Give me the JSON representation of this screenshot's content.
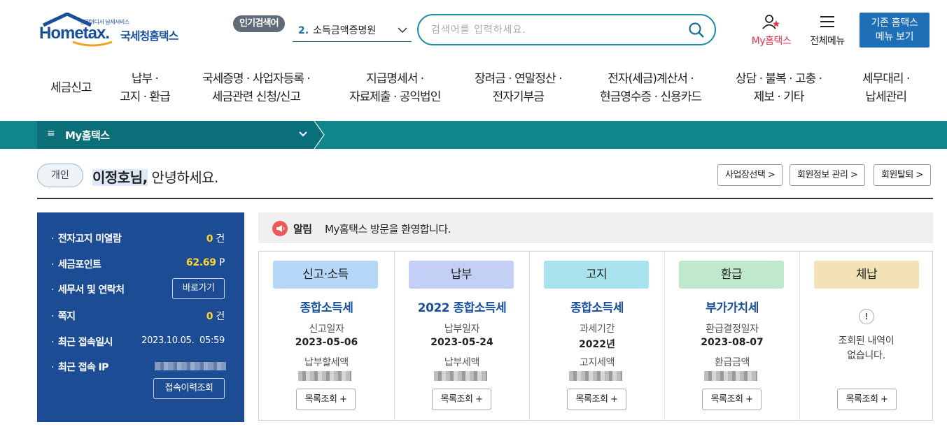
{
  "header": {
    "logo_sub": "언제어디서 납세서비스",
    "logo_word": "Hometax.",
    "logo_ko": "국세청홈택스",
    "popular_badge": "인기검색어",
    "popular_rank": "2.",
    "popular_term": "소득금액증명원",
    "search_placeholder": "검색어를 입력하세요.",
    "my_hometax": "My홈택스",
    "all_menu": "전체메뉴",
    "old_menu_line1": "기존 홈택스",
    "old_menu_line2": "메뉴 보기"
  },
  "gnb": [
    {
      "line1": "세금신고",
      "line2": ""
    },
    {
      "line1": "납부 ·",
      "line2": "고지 · 환급"
    },
    {
      "line1": "국세증명 · 사업자등록 ·",
      "line2": "세금관련 신청/신고"
    },
    {
      "line1": "지급명세서 ·",
      "line2": "자료제출 · 공익법인"
    },
    {
      "line1": "장려금 · 연말정산 ·",
      "line2": "전자기부금"
    },
    {
      "line1": "전자(세금)계산서 ·",
      "line2": "현금영수증 · 신용카드"
    },
    {
      "line1": "상담 · 불복 · 고충 ·",
      "line2": "제보 · 기타"
    },
    {
      "line1": "세무대리 ·",
      "line2": "납세관리"
    }
  ],
  "breadcrumb": {
    "menu_icon": "≡",
    "label": "My홈택스"
  },
  "greeting": {
    "badge": "개인",
    "name": "이정호님,",
    "rest": " 안녕하세요.",
    "btn_business": "사업장선택 >",
    "btn_member": "회원정보 관리 >",
    "btn_withdraw": "회원탈퇴 >"
  },
  "left_panel": {
    "unread_label": "전자고지 미열람",
    "unread_value": "0",
    "unread_unit": "건",
    "points_label": "세금포인트",
    "points_value": "62.69",
    "points_unit": "P",
    "office_label": "세무서 및 연락처",
    "office_btn": "바로가기",
    "memo_label": "쪽지",
    "memo_value": "0",
    "memo_unit": "건",
    "last_login_label": "최근 접속일시",
    "last_login_value": "2023.10.05.  05:59",
    "last_ip_label": "최근 접속 IP",
    "history_btn": "접속이력조회"
  },
  "notice": {
    "title": "알림",
    "message": "My홈택스 방문을 환영합니다."
  },
  "cards": [
    {
      "pill": "신고·소득",
      "color": "#b6d7f7",
      "title": "종합소득세",
      "label1": "신고일자",
      "value1": "2023-05-06",
      "label2": "납부할세액",
      "btn": "목록조회 +"
    },
    {
      "pill": "납부",
      "color": "#c3cff5",
      "title": "2022 종합소득세",
      "label1": "납부일자",
      "value1": "2023-05-24",
      "label2": "납부세액",
      "btn": "목록조회 +"
    },
    {
      "pill": "고지",
      "color": "#a9e3ee",
      "title": "종합소득세",
      "label1": "과세기간",
      "value1": "2022년",
      "label2": "고지세액",
      "btn": "목록조회 +"
    },
    {
      "pill": "환급",
      "color": "#bfe8cc",
      "title": "부가가치세",
      "label1": "환급결정일자",
      "value1": "2023-08-07",
      "label2": "환급금액",
      "btn": "목록조회 +"
    },
    {
      "pill": "체납",
      "color": "#f3e2b6",
      "empty1": "조회된 내역이",
      "empty2": "없습니다.",
      "btn": "목록조회 +"
    }
  ],
  "colors": {
    "brand": "#1a4f9c",
    "teal_bar": "#0f868b",
    "panel": "#1c4c93",
    "accent_red": "#e2354f"
  }
}
